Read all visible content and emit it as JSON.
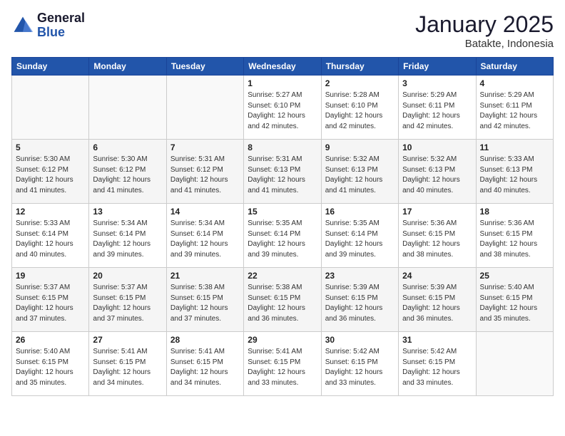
{
  "header": {
    "logo_line1": "General",
    "logo_line2": "Blue",
    "title": "January 2025",
    "subtitle": "Batakte, Indonesia"
  },
  "calendar": {
    "days_of_week": [
      "Sunday",
      "Monday",
      "Tuesday",
      "Wednesday",
      "Thursday",
      "Friday",
      "Saturday"
    ],
    "weeks": [
      [
        {
          "day": "",
          "info": ""
        },
        {
          "day": "",
          "info": ""
        },
        {
          "day": "",
          "info": ""
        },
        {
          "day": "1",
          "info": "Sunrise: 5:27 AM\nSunset: 6:10 PM\nDaylight: 12 hours\nand 42 minutes."
        },
        {
          "day": "2",
          "info": "Sunrise: 5:28 AM\nSunset: 6:10 PM\nDaylight: 12 hours\nand 42 minutes."
        },
        {
          "day": "3",
          "info": "Sunrise: 5:29 AM\nSunset: 6:11 PM\nDaylight: 12 hours\nand 42 minutes."
        },
        {
          "day": "4",
          "info": "Sunrise: 5:29 AM\nSunset: 6:11 PM\nDaylight: 12 hours\nand 42 minutes."
        }
      ],
      [
        {
          "day": "5",
          "info": "Sunrise: 5:30 AM\nSunset: 6:12 PM\nDaylight: 12 hours\nand 41 minutes."
        },
        {
          "day": "6",
          "info": "Sunrise: 5:30 AM\nSunset: 6:12 PM\nDaylight: 12 hours\nand 41 minutes."
        },
        {
          "day": "7",
          "info": "Sunrise: 5:31 AM\nSunset: 6:12 PM\nDaylight: 12 hours\nand 41 minutes."
        },
        {
          "day": "8",
          "info": "Sunrise: 5:31 AM\nSunset: 6:13 PM\nDaylight: 12 hours\nand 41 minutes."
        },
        {
          "day": "9",
          "info": "Sunrise: 5:32 AM\nSunset: 6:13 PM\nDaylight: 12 hours\nand 41 minutes."
        },
        {
          "day": "10",
          "info": "Sunrise: 5:32 AM\nSunset: 6:13 PM\nDaylight: 12 hours\nand 40 minutes."
        },
        {
          "day": "11",
          "info": "Sunrise: 5:33 AM\nSunset: 6:13 PM\nDaylight: 12 hours\nand 40 minutes."
        }
      ],
      [
        {
          "day": "12",
          "info": "Sunrise: 5:33 AM\nSunset: 6:14 PM\nDaylight: 12 hours\nand 40 minutes."
        },
        {
          "day": "13",
          "info": "Sunrise: 5:34 AM\nSunset: 6:14 PM\nDaylight: 12 hours\nand 39 minutes."
        },
        {
          "day": "14",
          "info": "Sunrise: 5:34 AM\nSunset: 6:14 PM\nDaylight: 12 hours\nand 39 minutes."
        },
        {
          "day": "15",
          "info": "Sunrise: 5:35 AM\nSunset: 6:14 PM\nDaylight: 12 hours\nand 39 minutes."
        },
        {
          "day": "16",
          "info": "Sunrise: 5:35 AM\nSunset: 6:14 PM\nDaylight: 12 hours\nand 39 minutes."
        },
        {
          "day": "17",
          "info": "Sunrise: 5:36 AM\nSunset: 6:15 PM\nDaylight: 12 hours\nand 38 minutes."
        },
        {
          "day": "18",
          "info": "Sunrise: 5:36 AM\nSunset: 6:15 PM\nDaylight: 12 hours\nand 38 minutes."
        }
      ],
      [
        {
          "day": "19",
          "info": "Sunrise: 5:37 AM\nSunset: 6:15 PM\nDaylight: 12 hours\nand 37 minutes."
        },
        {
          "day": "20",
          "info": "Sunrise: 5:37 AM\nSunset: 6:15 PM\nDaylight: 12 hours\nand 37 minutes."
        },
        {
          "day": "21",
          "info": "Sunrise: 5:38 AM\nSunset: 6:15 PM\nDaylight: 12 hours\nand 37 minutes."
        },
        {
          "day": "22",
          "info": "Sunrise: 5:38 AM\nSunset: 6:15 PM\nDaylight: 12 hours\nand 36 minutes."
        },
        {
          "day": "23",
          "info": "Sunrise: 5:39 AM\nSunset: 6:15 PM\nDaylight: 12 hours\nand 36 minutes."
        },
        {
          "day": "24",
          "info": "Sunrise: 5:39 AM\nSunset: 6:15 PM\nDaylight: 12 hours\nand 36 minutes."
        },
        {
          "day": "25",
          "info": "Sunrise: 5:40 AM\nSunset: 6:15 PM\nDaylight: 12 hours\nand 35 minutes."
        }
      ],
      [
        {
          "day": "26",
          "info": "Sunrise: 5:40 AM\nSunset: 6:15 PM\nDaylight: 12 hours\nand 35 minutes."
        },
        {
          "day": "27",
          "info": "Sunrise: 5:41 AM\nSunset: 6:15 PM\nDaylight: 12 hours\nand 34 minutes."
        },
        {
          "day": "28",
          "info": "Sunrise: 5:41 AM\nSunset: 6:15 PM\nDaylight: 12 hours\nand 34 minutes."
        },
        {
          "day": "29",
          "info": "Sunrise: 5:41 AM\nSunset: 6:15 PM\nDaylight: 12 hours\nand 33 minutes."
        },
        {
          "day": "30",
          "info": "Sunrise: 5:42 AM\nSunset: 6:15 PM\nDaylight: 12 hours\nand 33 minutes."
        },
        {
          "day": "31",
          "info": "Sunrise: 5:42 AM\nSunset: 6:15 PM\nDaylight: 12 hours\nand 33 minutes."
        },
        {
          "day": "",
          "info": ""
        }
      ]
    ]
  }
}
